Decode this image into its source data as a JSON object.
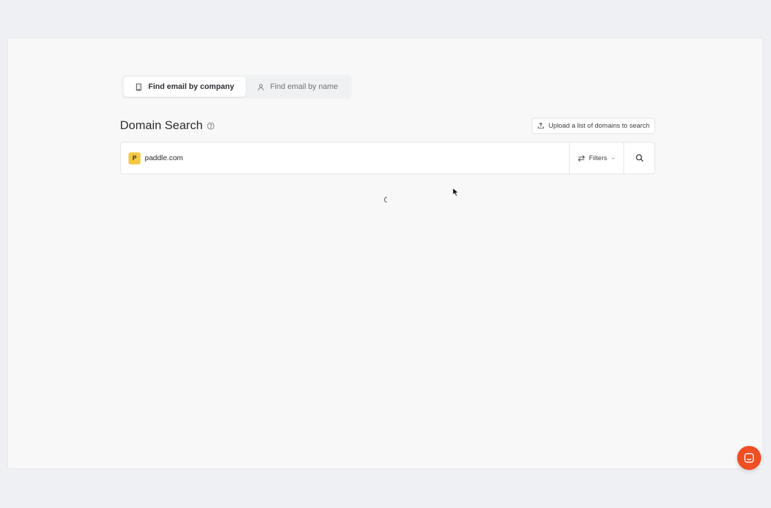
{
  "tabs": [
    {
      "label": "Find email by company",
      "icon": "building-icon",
      "active": true
    },
    {
      "label": "Find email by name",
      "icon": "user-icon",
      "active": false
    }
  ],
  "header": {
    "title": "Domain Search",
    "help_icon": "help-circle-icon",
    "upload_label": "Upload a list of domains to search",
    "upload_icon": "upload-icon"
  },
  "search": {
    "favicon_letter": "P",
    "domain_value": "paddle.com",
    "filters_label": "Filters",
    "filters_icon": "swap-arrows-icon",
    "dropdown_icon": "chevron-down-icon",
    "search_icon": "search-icon"
  },
  "colors": {
    "accent": "#f04e23",
    "favicon_bg": "#f5c842",
    "page_bg": "#eef0f3",
    "card_bg": "#f8f8f8"
  }
}
